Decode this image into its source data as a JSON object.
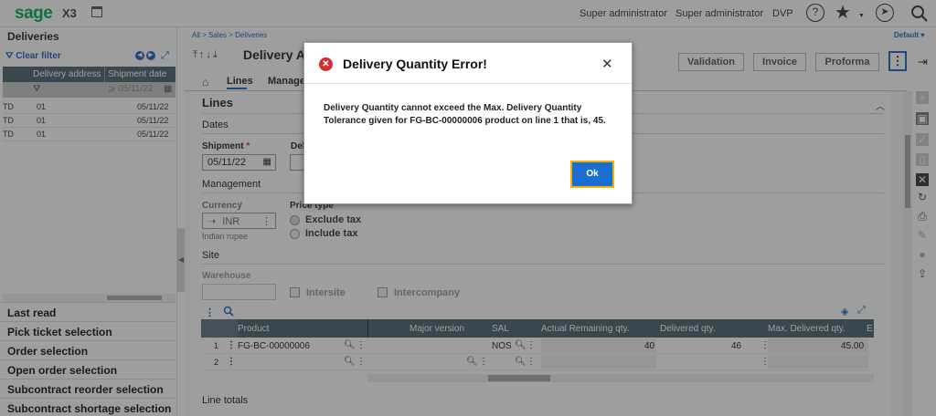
{
  "topbar": {
    "logo": "sage",
    "app": "X3",
    "user1": "Super administrator",
    "user2": "Super administrator",
    "folder": "DVP"
  },
  "left": {
    "title": "Deliveries",
    "clear_filter": "Clear filter",
    "columns": [
      "Delivery address",
      "Shipment date"
    ],
    "filter_date": "05/11/22",
    "rows": [
      {
        "code": "TD",
        "addr": "01",
        "date": "05/11/22"
      },
      {
        "code": "TD",
        "addr": "01",
        "date": "05/11/22"
      },
      {
        "code": "TD",
        "addr": "01",
        "date": "05/11/22"
      }
    ],
    "nav": [
      "Last read",
      "Pick ticket selection",
      "Order selection",
      "Open order selection",
      "Subcontract reorder selection",
      "Subcontract shortage selection"
    ]
  },
  "main": {
    "breadcrumb": [
      "All",
      "Sales",
      "Deliveries"
    ],
    "default": "Default",
    "title": "Delivery Al",
    "buttons": [
      "Validation",
      "Invoice",
      "Proforma"
    ],
    "tabs": [
      "Lines",
      "Manage"
    ],
    "section": "Lines",
    "dates_label": "Dates",
    "shipment_label": "Shipment",
    "shipment_value": "05/11/22",
    "deli_label": "Deli",
    "management_label": "Management",
    "currency_label": "Currency",
    "currency_value": "INR",
    "currency_desc": "Indian rupee",
    "price_type_label": "Price type",
    "exclude_tax": "Exclude tax",
    "include_tax": "Include tax",
    "site_label": "Site",
    "warehouse_label": "Warehouse",
    "intersite": "Intersite",
    "intercompany": "Intercompany",
    "table_columns": [
      "Product",
      "Major version",
      "SAL",
      "Actual Remaining qty.",
      "Delivered qty.",
      "Max. Delivered qty.",
      "E"
    ],
    "table_rows": [
      {
        "n": "1",
        "product": "FG-BC-00000006",
        "sal": "NOS",
        "remaining": "40",
        "delivered": "46",
        "max": "45.00"
      },
      {
        "n": "2",
        "product": "",
        "sal": "",
        "remaining": "",
        "delivered": "",
        "max": ""
      }
    ],
    "line_totals": "Line totals"
  },
  "dialog": {
    "title": "Delivery Quantity Error!",
    "message": "Delivery Quantity cannot exceed the Max. Delivery Quantity Tolerance given for FG-BC-00000006 product on line 1 that is, 45.",
    "ok": "Ok"
  }
}
